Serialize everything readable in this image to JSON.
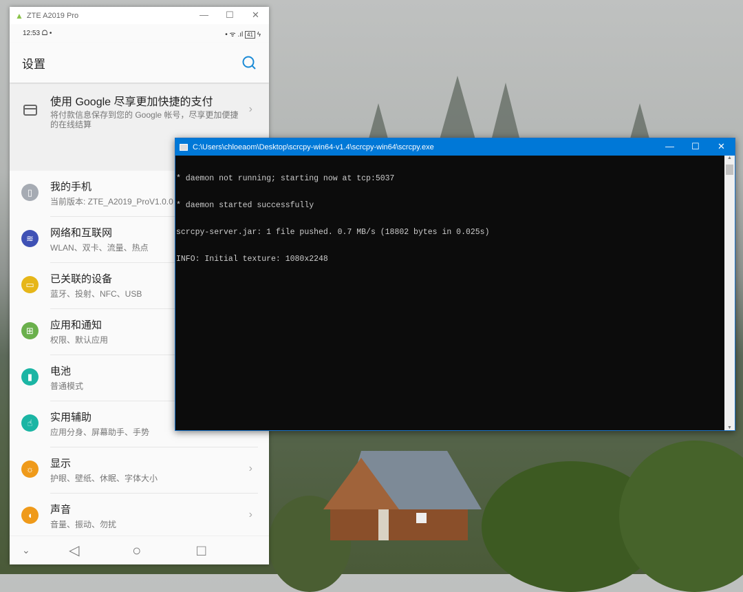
{
  "phone_window": {
    "title": "ZTE A2019 Pro",
    "minimize": "—",
    "maximize": "☐",
    "close": "✕"
  },
  "status_bar": {
    "time": "12:53",
    "left_icons": "ᗝ •",
    "right_icons": "• ᯤ .ıl",
    "battery": "41",
    "charging": "ϟ"
  },
  "settings": {
    "title": "设置",
    "search_icon": "search-icon",
    "google_card": {
      "title": "使用 Google 尽享更加快捷的支付",
      "subtitle": "将付款信息保存到您的 Google 帐号，尽享更加便捷的在线结算"
    },
    "items": [
      {
        "title": "我的手机",
        "subtitle": "当前版本: ZTE_A2019_ProV1.0.0",
        "icon": "phone-icon",
        "color": "#a6abb3"
      },
      {
        "title": "网络和互联网",
        "subtitle": "WLAN、双卡、流量、热点",
        "icon": "wifi-icon",
        "color": "#3f51b5"
      },
      {
        "title": "已关联的设备",
        "subtitle": "蓝牙、投射、NFC、USB",
        "icon": "devices-icon",
        "color": "#e6b619"
      },
      {
        "title": "应用和通知",
        "subtitle": "权限、默认应用",
        "icon": "apps-icon",
        "color": "#6ab04c"
      },
      {
        "title": "电池",
        "subtitle": "普通模式",
        "icon": "battery-icon",
        "color": "#1bb5a4"
      },
      {
        "title": "实用辅助",
        "subtitle": "应用分身、屏幕助手、手势",
        "icon": "hand-icon",
        "color": "#1bb5a4"
      },
      {
        "title": "显示",
        "subtitle": "护眼、壁纸、休眠、字体大小",
        "icon": "brightness-icon",
        "color": "#ef9a1a"
      },
      {
        "title": "声音",
        "subtitle": "音量、振动、勿扰",
        "icon": "volume-icon",
        "color": "#ef9a1a"
      }
    ]
  },
  "nav_bar": {
    "collapse": "⌄",
    "back": "◁",
    "home": "○",
    "recents": "□"
  },
  "console": {
    "title": "C:\\Users\\chloeaom\\Desktop\\scrcpy-win64-v1.4\\scrcpy-win64\\scrcpy.exe",
    "lines": [
      "* daemon not running; starting now at tcp:5037",
      "* daemon started successfully",
      "scrcpy-server.jar: 1 file pushed. 0.7 MB/s (18802 bytes in 0.025s)",
      "INFO: Initial texture: 1080x2248"
    ],
    "minimize": "—",
    "maximize": "☐",
    "close": "✕",
    "scroll_up": "▲",
    "scroll_down": "▼"
  }
}
